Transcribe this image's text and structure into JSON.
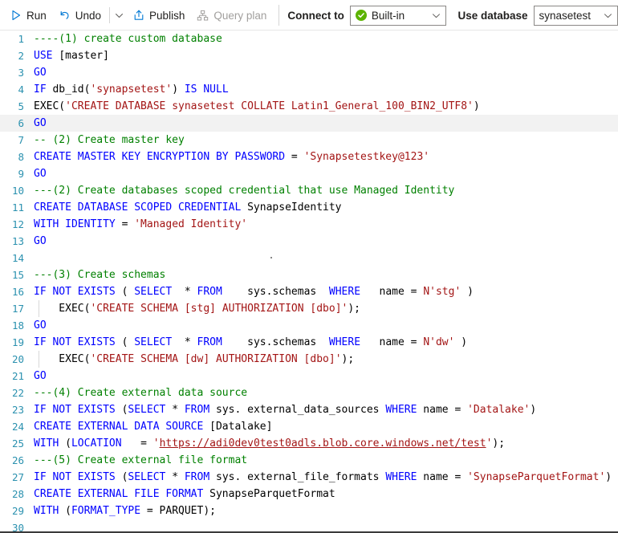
{
  "toolbar": {
    "run_label": "Run",
    "run_icon": "play-triangle-icon",
    "undo_label": "Undo",
    "undo_icon": "undo-arrow-icon",
    "more_icon": "chevron-down-icon",
    "publish_label": "Publish",
    "publish_icon": "publish-upload-icon",
    "query_plan_label": "Query plan",
    "query_plan_icon": "query-plan-hierarchy-icon",
    "connect_to_label": "Connect to",
    "connect_to_value": "Built-in",
    "connect_to_status_icon": "green-check-circle-icon",
    "connect_to_caret_icon": "chevron-down-icon",
    "use_database_label": "Use database",
    "use_database_value": "synasetest",
    "use_database_caret_icon": "chevron-down-icon",
    "accent_color": "#0078d4",
    "status_color": "#5cb300"
  },
  "editor": {
    "language": "sql",
    "current_line": 6,
    "lines": [
      {
        "n": "1",
        "tokens": [
          {
            "t": "----(1) create custom database",
            "c": "cmt"
          }
        ]
      },
      {
        "n": "2",
        "tokens": [
          {
            "t": "USE ",
            "c": "kw"
          },
          {
            "t": "[master]",
            "c": "pl"
          }
        ]
      },
      {
        "n": "3",
        "tokens": [
          {
            "t": "GO",
            "c": "kw"
          }
        ]
      },
      {
        "n": "4",
        "tokens": [
          {
            "t": "IF ",
            "c": "kw"
          },
          {
            "t": "db_id(",
            "c": "pl"
          },
          {
            "t": "'synapsetest'",
            "c": "str"
          },
          {
            "t": ") ",
            "c": "pl"
          },
          {
            "t": "IS NULL",
            "c": "kw"
          }
        ]
      },
      {
        "n": "5",
        "tokens": [
          {
            "t": "EXEC(",
            "c": "pl"
          },
          {
            "t": "'CREATE DATABASE synasetest COLLATE Latin1_General_100_BIN2_UTF8'",
            "c": "str"
          },
          {
            "t": ")",
            "c": "pl"
          }
        ]
      },
      {
        "n": "6",
        "tokens": [
          {
            "t": "GO",
            "c": "kw"
          }
        ]
      },
      {
        "n": "7",
        "tokens": [
          {
            "t": "-- (2) Create master key",
            "c": "cmt"
          }
        ]
      },
      {
        "n": "8",
        "tokens": [
          {
            "t": "CREATE MASTER KEY ENCRYPTION BY PASSWORD ",
            "c": "kw"
          },
          {
            "t": "= ",
            "c": "pl"
          },
          {
            "t": "'Synapsetestkey@123'",
            "c": "str"
          }
        ]
      },
      {
        "n": "9",
        "tokens": [
          {
            "t": "GO",
            "c": "kw"
          }
        ]
      },
      {
        "n": "10",
        "tokens": [
          {
            "t": "---(2) Create databases scoped credential that use Managed Identity",
            "c": "cmt"
          }
        ]
      },
      {
        "n": "11",
        "tokens": [
          {
            "t": "CREATE DATABASE SCOPED CREDENTIAL ",
            "c": "kw"
          },
          {
            "t": "SynapseIdentity",
            "c": "pl"
          }
        ]
      },
      {
        "n": "12",
        "tokens": [
          {
            "t": "WITH IDENTITY ",
            "c": "kw"
          },
          {
            "t": "= ",
            "c": "pl"
          },
          {
            "t": "'Managed Identity'",
            "c": "str"
          }
        ]
      },
      {
        "n": "13",
        "tokens": [
          {
            "t": "GO",
            "c": "kw"
          }
        ]
      },
      {
        "n": "14",
        "tokens": [
          {
            "t": "",
            "c": "pl"
          }
        ]
      },
      {
        "n": "15",
        "tokens": [
          {
            "t": "---(3) Create schemas",
            "c": "cmt"
          }
        ]
      },
      {
        "n": "16",
        "tokens": [
          {
            "t": "IF NOT EXISTS ",
            "c": "kw"
          },
          {
            "t": "( ",
            "c": "pl"
          },
          {
            "t": "SELECT ",
            "c": "kw"
          },
          {
            "t": " * ",
            "c": "pl"
          },
          {
            "t": "FROM",
            "c": "kw"
          },
          {
            "t": "    sys.schemas  ",
            "c": "pl"
          },
          {
            "t": "WHERE",
            "c": "kw"
          },
          {
            "t": "   name ",
            "c": "pl"
          },
          {
            "t": "= ",
            "c": "pl"
          },
          {
            "t": "N'stg'",
            "c": "str"
          },
          {
            "t": " )",
            "c": "pl"
          }
        ]
      },
      {
        "n": "17",
        "tokens": [
          {
            "t": "    EXEC(",
            "c": "pl"
          },
          {
            "t": "'CREATE SCHEMA [stg] AUTHORIZATION [dbo]'",
            "c": "str"
          },
          {
            "t": ");",
            "c": "pl"
          }
        ]
      },
      {
        "n": "18",
        "tokens": [
          {
            "t": "GO",
            "c": "kw"
          }
        ]
      },
      {
        "n": "19",
        "tokens": [
          {
            "t": "IF NOT EXISTS ",
            "c": "kw"
          },
          {
            "t": "( ",
            "c": "pl"
          },
          {
            "t": "SELECT ",
            "c": "kw"
          },
          {
            "t": " * ",
            "c": "pl"
          },
          {
            "t": "FROM",
            "c": "kw"
          },
          {
            "t": "    sys.schemas  ",
            "c": "pl"
          },
          {
            "t": "WHERE",
            "c": "kw"
          },
          {
            "t": "   name ",
            "c": "pl"
          },
          {
            "t": "= ",
            "c": "pl"
          },
          {
            "t": "N'dw'",
            "c": "str"
          },
          {
            "t": " )",
            "c": "pl"
          }
        ]
      },
      {
        "n": "20",
        "tokens": [
          {
            "t": "    EXEC(",
            "c": "pl"
          },
          {
            "t": "'CREATE SCHEMA [dw] AUTHORIZATION [dbo]'",
            "c": "str"
          },
          {
            "t": ");",
            "c": "pl"
          }
        ]
      },
      {
        "n": "21",
        "tokens": [
          {
            "t": "GO",
            "c": "kw"
          }
        ]
      },
      {
        "n": "22",
        "tokens": [
          {
            "t": "---(4) Create external data source",
            "c": "cmt"
          }
        ]
      },
      {
        "n": "23",
        "tokens": [
          {
            "t": "IF NOT EXISTS ",
            "c": "kw"
          },
          {
            "t": "(",
            "c": "pl"
          },
          {
            "t": "SELECT ",
            "c": "kw"
          },
          {
            "t": "* ",
            "c": "pl"
          },
          {
            "t": "FROM ",
            "c": "kw"
          },
          {
            "t": "sys. external_data_sources ",
            "c": "pl"
          },
          {
            "t": "WHERE ",
            "c": "kw"
          },
          {
            "t": "name ",
            "c": "pl"
          },
          {
            "t": "= ",
            "c": "pl"
          },
          {
            "t": "'Datalake'",
            "c": "str"
          },
          {
            "t": ")",
            "c": "pl"
          }
        ]
      },
      {
        "n": "24",
        "tokens": [
          {
            "t": "CREATE EXTERNAL DATA SOURCE ",
            "c": "kw"
          },
          {
            "t": "[Datalake]",
            "c": "pl"
          }
        ]
      },
      {
        "n": "25",
        "tokens": [
          {
            "t": "WITH ",
            "c": "kw"
          },
          {
            "t": "(",
            "c": "pl"
          },
          {
            "t": "LOCATION",
            "c": "kw"
          },
          {
            "t": "   = ",
            "c": "pl"
          },
          {
            "t": "'",
            "c": "str"
          },
          {
            "t": "https://adi0dev0test0adls.blob.core.windows.net/test",
            "c": "url"
          },
          {
            "t": "'",
            "c": "str"
          },
          {
            "t": ");",
            "c": "pl"
          }
        ]
      },
      {
        "n": "26",
        "tokens": [
          {
            "t": "---(5) Create external file format",
            "c": "cmt"
          }
        ]
      },
      {
        "n": "27",
        "tokens": [
          {
            "t": "IF NOT EXISTS ",
            "c": "kw"
          },
          {
            "t": "(",
            "c": "pl"
          },
          {
            "t": "SELECT ",
            "c": "kw"
          },
          {
            "t": "* ",
            "c": "pl"
          },
          {
            "t": "FROM ",
            "c": "kw"
          },
          {
            "t": "sys. external_file_formats ",
            "c": "pl"
          },
          {
            "t": "WHERE ",
            "c": "kw"
          },
          {
            "t": "name ",
            "c": "pl"
          },
          {
            "t": "= ",
            "c": "pl"
          },
          {
            "t": "'SynapseParquetFormat'",
            "c": "str"
          },
          {
            "t": ")",
            "c": "pl"
          }
        ]
      },
      {
        "n": "28",
        "tokens": [
          {
            "t": "CREATE EXTERNAL FILE FORMAT ",
            "c": "kw"
          },
          {
            "t": "SynapseParquetFormat",
            "c": "pl"
          }
        ]
      },
      {
        "n": "29",
        "tokens": [
          {
            "t": "WITH ",
            "c": "kw"
          },
          {
            "t": "(",
            "c": "pl"
          },
          {
            "t": "FORMAT_TYPE",
            "c": "kw"
          },
          {
            "t": " = ",
            "c": "pl"
          },
          {
            "t": "PARQUET);",
            "c": "pl"
          }
        ]
      },
      {
        "n": "30",
        "tokens": [
          {
            "t": "",
            "c": "pl"
          }
        ]
      }
    ]
  }
}
